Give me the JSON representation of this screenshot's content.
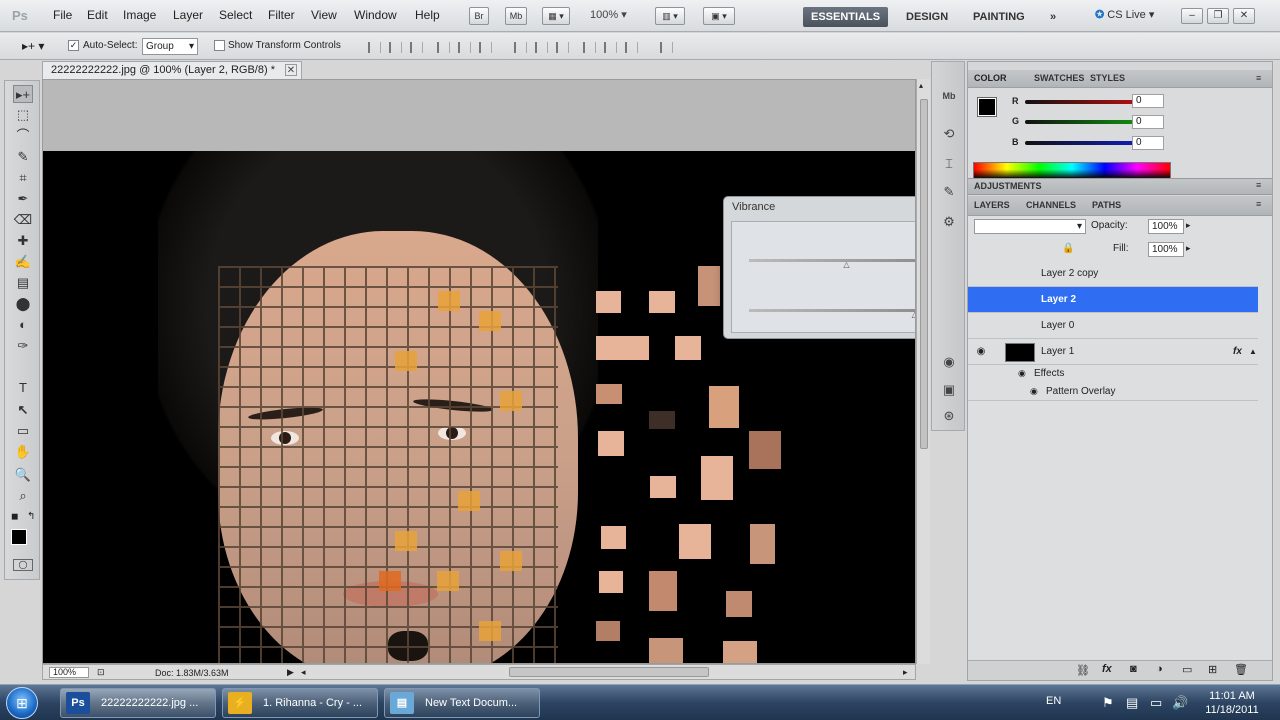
{
  "app": {
    "logo": "Ps",
    "menu": [
      "File",
      "Edit",
      "Image",
      "Layer",
      "Select",
      "Filter",
      "View",
      "Window",
      "Help"
    ],
    "quick_buttons": [
      "Br",
      "Mb"
    ],
    "zoom": "100%",
    "workspaces": [
      "ESSENTIALS",
      "DESIGN",
      "PAINTING"
    ],
    "more": "»",
    "cs_live": "CS Live",
    "window_controls": [
      "–",
      "❐",
      "✕"
    ]
  },
  "options_bar": {
    "auto_select_label": "Auto-Select:",
    "auto_select_value": "Group",
    "show_transform_label": "Show Transform Controls"
  },
  "document": {
    "tab_title": "22222222222.jpg @ 100% (Layer 2, RGB/8) *",
    "tab_close": "✕",
    "status_zoom": "100%",
    "status_doc": "Doc: 1.83M/3.63M"
  },
  "tools": [
    "▸+",
    "⬚",
    "⌒",
    "✎",
    "⌗",
    "✒",
    "⌫",
    "✚",
    "✍",
    "▤",
    "⬤",
    "◐",
    "✑",
    "T",
    "↖",
    "▭",
    "✋",
    "🔍"
  ],
  "color_panel": {
    "tabs": [
      "COLOR",
      "SWATCHES",
      "STYLES"
    ],
    "channels": [
      {
        "label": "R",
        "value": "0",
        "color": "#cc1010"
      },
      {
        "label": "G",
        "value": "0",
        "color": "#10a010"
      },
      {
        "label": "B",
        "value": "0",
        "color": "#1020cc"
      }
    ]
  },
  "adjustments": {
    "title": "ADJUSTMENTS"
  },
  "layers_panel": {
    "tabs": [
      "LAYERS",
      "CHANNELS",
      "PATHS"
    ],
    "opacity_label": "Opacity:",
    "opacity_value": "100%",
    "fill_label": "Fill:",
    "fill_value": "100%",
    "layers": [
      {
        "name": "Layer 2 copy",
        "selected": false
      },
      {
        "name": "Layer 2",
        "selected": true
      },
      {
        "name": "Layer 0",
        "selected": false
      },
      {
        "name": "Layer 1",
        "selected": false
      }
    ],
    "effects_label": "Effects",
    "pattern_overlay_label": "Pattern Overlay",
    "fx": "fx"
  },
  "vibrance_dialog": {
    "title": "Vibrance",
    "close": "✕",
    "vibrance_level": 0.5,
    "saturation_level": 0.85
  },
  "taskbar": {
    "start": "⊞",
    "items": [
      {
        "label": "22222222222.jpg ...",
        "icon": "Ps",
        "icon_color": "#1b4f9c"
      },
      {
        "label": "1. Rihanna - Cry - ...",
        "icon": "⚡",
        "icon_color": "#e8b020"
      },
      {
        "label": "New Text Docum...",
        "icon": "▤",
        "icon_color": "#6aa8d8"
      }
    ],
    "lang": "EN",
    "time": "11:01 AM",
    "date": "11/18/2011"
  }
}
